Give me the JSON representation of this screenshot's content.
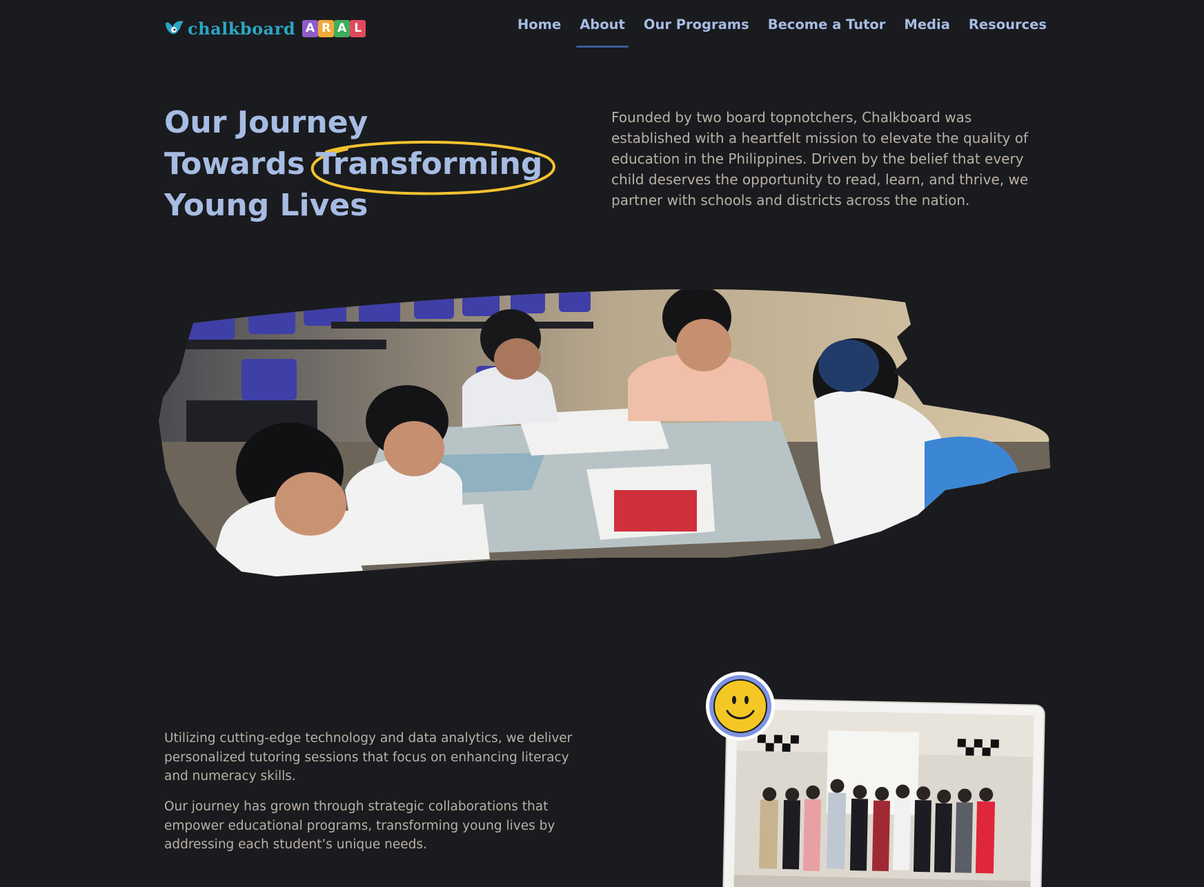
{
  "brand": {
    "name": "chalkboard",
    "tiles": [
      "A",
      "R",
      "A",
      "L"
    ],
    "tile_colors": [
      "#8e5cc9",
      "#f2a93b",
      "#3fae5a",
      "#e04a5e"
    ],
    "word_color": "#2aa7c4"
  },
  "nav": {
    "items": [
      {
        "label": "Home"
      },
      {
        "label": "About"
      },
      {
        "label": "Our Programs"
      },
      {
        "label": "Become a Tutor"
      },
      {
        "label": "Media"
      },
      {
        "label": "Resources"
      }
    ],
    "active": "About"
  },
  "hero": {
    "title_line1": "Our Journey",
    "title_line2a": "Towards ",
    "title_highlight": "Transforming",
    "title_line3": "Young Lives",
    "description": "Founded by two board topnotchers, Chalkboard was established with a heartfelt mission to elevate the quality of education in the Philippines. Driven by the belief that every child deserves the opportunity to read, learn, and thrive, we partner with schools and districts across the nation."
  },
  "body": {
    "paragraph1": "Utilizing cutting-edge technology and data analytics, we deliver personalized tutoring sessions that focus on enhancing literacy and numeracy skills.",
    "paragraph2": "Our journey has grown through strategic collaborations that empower educational programs, transforming young lives by addressing each student’s unique needs."
  },
  "colors": {
    "background": "#1a1b1e",
    "heading": "#a7bce3",
    "body_text": "#b9b1a7",
    "highlight_ellipse": "#f2c230",
    "active_underline": "#3d5a96"
  },
  "icons": {
    "logo": "bird-icon",
    "badge": "smiley-icon"
  }
}
